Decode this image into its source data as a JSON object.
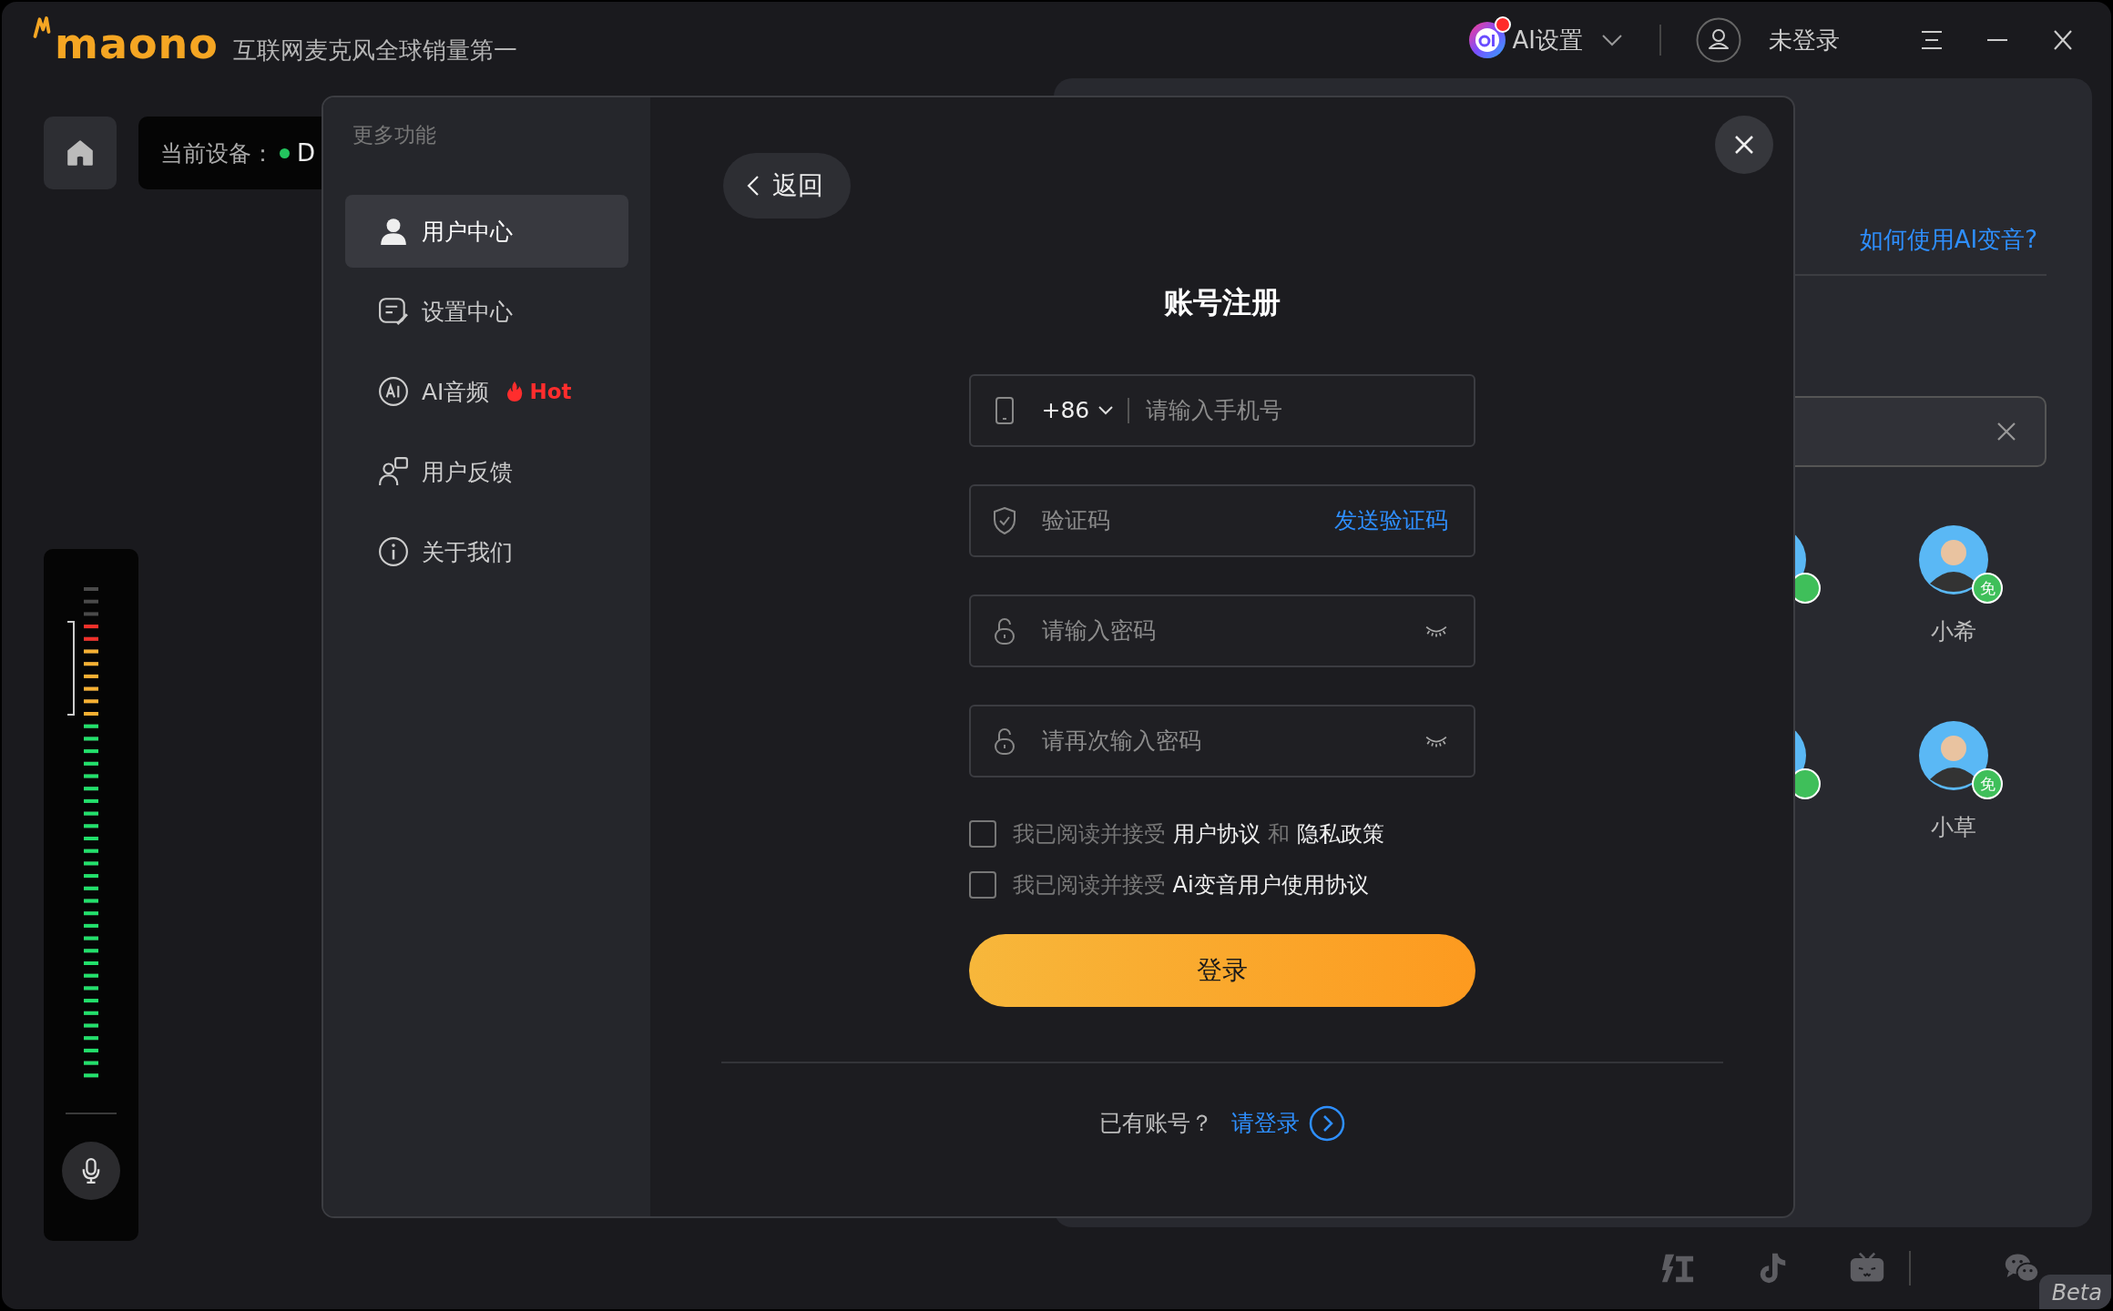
{
  "header": {
    "brand": "maono",
    "slogan": "互联网麦克风全球销量第一",
    "ai_settings": {
      "label": "AI设置",
      "notification": true
    },
    "user": {
      "label": "未登录"
    }
  },
  "device": {
    "label": "当前设备：",
    "name": "D",
    "connected": true
  },
  "meter": {
    "level": 0.93
  },
  "voice_panel": {
    "help_link": "如何使用AI变音?",
    "voices": [
      {
        "kind": "partial"
      },
      {
        "kind": "full",
        "name": "小希",
        "badge": "免"
      },
      {
        "kind": "partial"
      },
      {
        "kind": "full",
        "name": "小草",
        "badge": "免"
      }
    ]
  },
  "modal": {
    "sidebar_title": "更多功能",
    "menu": [
      {
        "kind": "user",
        "label": "用户中心",
        "selected": true
      },
      {
        "kind": "settings",
        "label": "设置中心",
        "selected": false
      },
      {
        "kind": "ai",
        "label": "AI音频",
        "selected": false,
        "tag": "Hot"
      },
      {
        "kind": "feedback",
        "label": "用户反馈",
        "selected": false
      },
      {
        "kind": "info",
        "label": "关于我们",
        "selected": false
      }
    ],
    "back": "返回",
    "title": "账号注册",
    "fields": [
      {
        "kind": "phone",
        "country_code": "+86",
        "placeholder": "请输入手机号"
      },
      {
        "kind": "code",
        "placeholder": "验证码",
        "action": "发送验证码"
      },
      {
        "kind": "password",
        "placeholder": "请输入密码"
      },
      {
        "kind": "password",
        "placeholder": "请再次输入密码"
      }
    ],
    "agreements": [
      {
        "checked": false,
        "parts": [
          {
            "text": "我已阅读并接受",
            "link": false
          },
          {
            "text": "用户协议",
            "link": true
          },
          {
            "text": "和",
            "link": false
          },
          {
            "text": "隐私政策",
            "link": true
          }
        ]
      },
      {
        "checked": false,
        "parts": [
          {
            "text": "我已阅读并接受",
            "link": false
          },
          {
            "text": "Ai变音用户使用协议",
            "link": true
          }
        ]
      }
    ],
    "submit": "登录",
    "footer": {
      "prompt": "已有账号？",
      "link": "请登录"
    }
  },
  "beta": "Beta"
}
